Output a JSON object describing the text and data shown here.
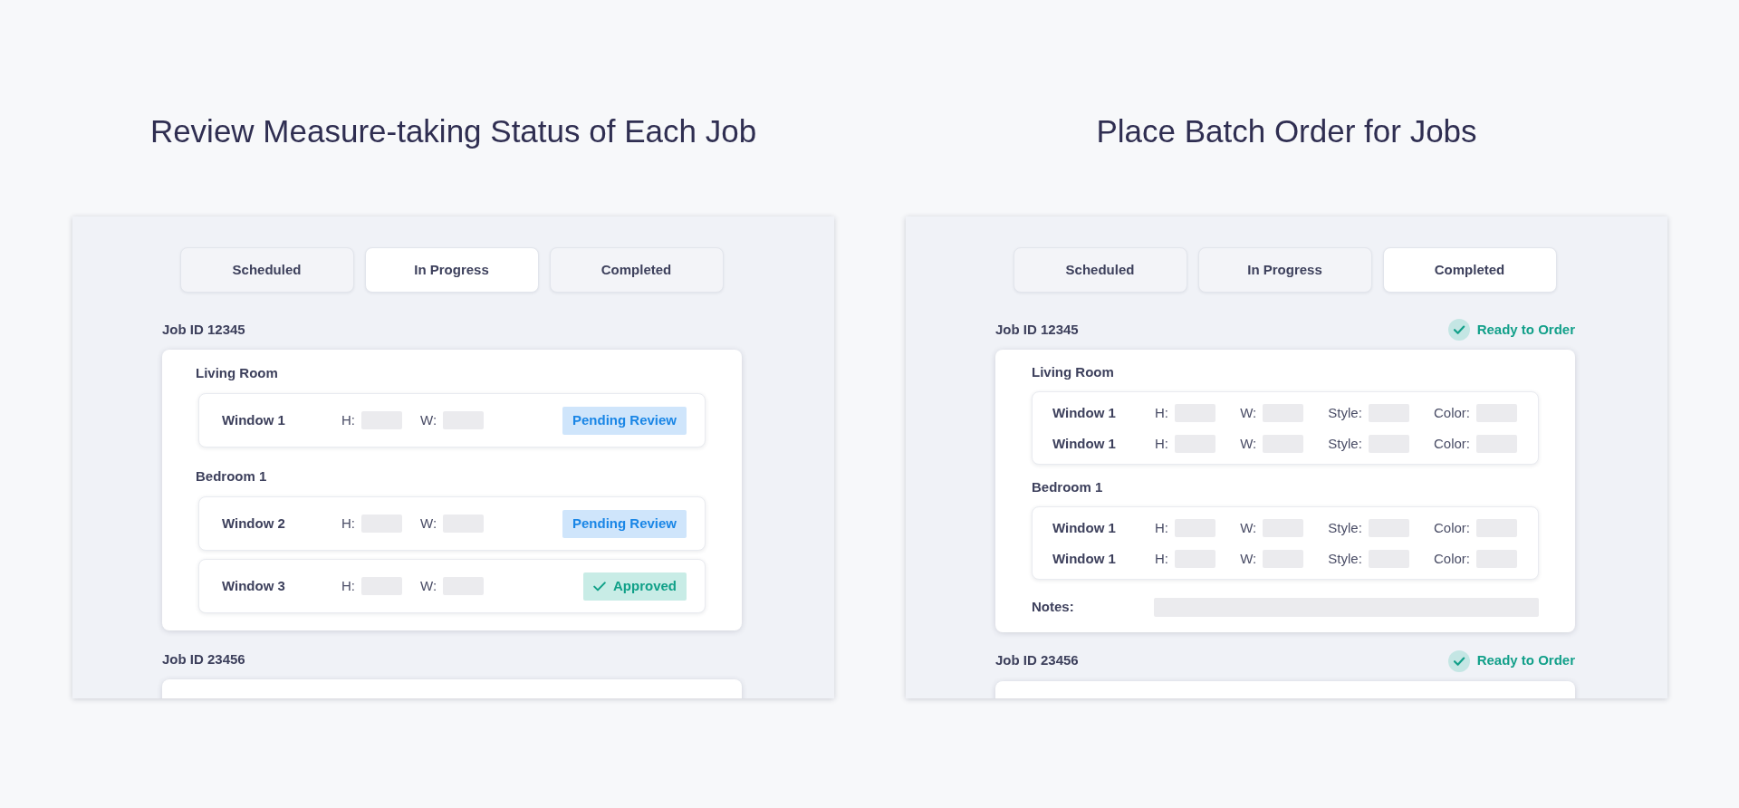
{
  "panels": [
    {
      "kind": "review",
      "title": "Review Measure-taking Status of Each Job",
      "tabs": [
        {
          "label": "Scheduled",
          "selected": false
        },
        {
          "label": "In Progress",
          "selected": true
        },
        {
          "label": "Completed",
          "selected": false
        }
      ],
      "jobs": [
        {
          "job_id": "Job ID 12345",
          "rooms": [
            {
              "name": "Living Room",
              "windows": [
                {
                  "name": "Window 1",
                  "fields": [
                    {
                      "label": "H:"
                    },
                    {
                      "label": "W:"
                    }
                  ],
                  "status": {
                    "kind": "pending",
                    "label": "Pending Review"
                  }
                }
              ]
            },
            {
              "name": "Bedroom 1",
              "windows": [
                {
                  "name": "Window 2",
                  "fields": [
                    {
                      "label": "H:"
                    },
                    {
                      "label": "W:"
                    }
                  ],
                  "status": {
                    "kind": "pending",
                    "label": "Pending Review"
                  }
                },
                {
                  "name": "Window 3",
                  "fields": [
                    {
                      "label": "H:"
                    },
                    {
                      "label": "W:"
                    }
                  ],
                  "status": {
                    "kind": "approved",
                    "label": "Approved"
                  }
                }
              ]
            }
          ]
        },
        {
          "job_id": "Job ID 23456"
        }
      ]
    },
    {
      "kind": "order",
      "title": "Place Batch Order for Jobs",
      "tabs": [
        {
          "label": "Scheduled",
          "selected": false
        },
        {
          "label": "In Progress",
          "selected": false
        },
        {
          "label": "Completed",
          "selected": true
        }
      ],
      "jobs": [
        {
          "job_id": "Job ID 12345",
          "status": {
            "kind": "ready",
            "label": "Ready to Order"
          },
          "rooms": [
            {
              "name": "Living Room",
              "windows": [
                {
                  "name": "Window 1",
                  "fields": [
                    {
                      "label": "H:"
                    },
                    {
                      "label": "W:"
                    },
                    {
                      "label": "Style:"
                    },
                    {
                      "label": "Color:"
                    }
                  ]
                },
                {
                  "name": "Window 1",
                  "fields": [
                    {
                      "label": "H:"
                    },
                    {
                      "label": "W:"
                    },
                    {
                      "label": "Style:"
                    },
                    {
                      "label": "Color:"
                    }
                  ]
                }
              ]
            },
            {
              "name": "Bedroom 1",
              "windows": [
                {
                  "name": "Window 1",
                  "fields": [
                    {
                      "label": "H:"
                    },
                    {
                      "label": "W:"
                    },
                    {
                      "label": "Style:"
                    },
                    {
                      "label": "Color:"
                    }
                  ]
                },
                {
                  "name": "Window 1",
                  "fields": [
                    {
                      "label": "H:"
                    },
                    {
                      "label": "W:"
                    },
                    {
                      "label": "Style:"
                    },
                    {
                      "label": "Color:"
                    }
                  ]
                }
              ]
            }
          ],
          "notes": {
            "label": "Notes:"
          }
        },
        {
          "job_id": "Job ID 23456",
          "status": {
            "kind": "ready",
            "label": "Ready to Order"
          }
        }
      ]
    }
  ]
}
